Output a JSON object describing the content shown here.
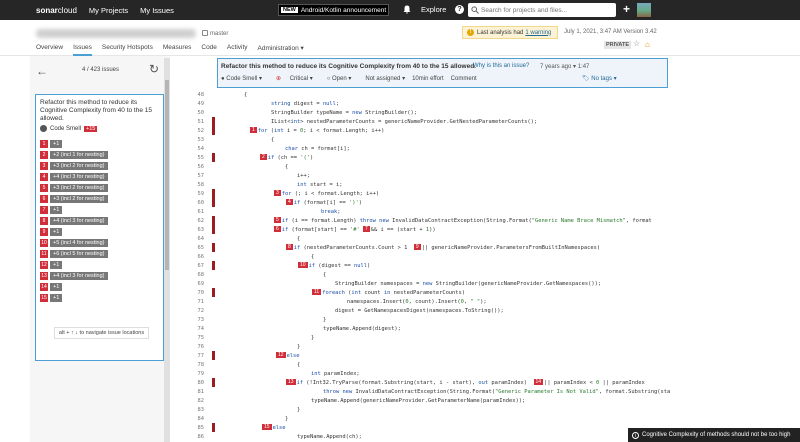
{
  "topbar": {
    "logo_bold": "sonar",
    "logo_rest": "cloud",
    "nav": [
      "My Projects",
      "My Issues"
    ],
    "news_tag": "NEW",
    "news_text": "Android/Kotlin announcement",
    "explore": "Explore",
    "help": "?",
    "search_placeholder": "Search for projects and files...",
    "plus": "+"
  },
  "project": {
    "branch": "master",
    "warning_text": "Last analysis had",
    "warning_link": "1 warning",
    "analysis_date": "July 1, 2021, 3:47 AM  Version 3.42",
    "visibility": "PRIVATE",
    "tabs": [
      "Overview",
      "Issues",
      "Security Hotspots",
      "Measures",
      "Code",
      "Activity",
      "Administration ▾"
    ],
    "active_tab": "Issues"
  },
  "sidebar": {
    "issue_count": "4 / 423 issues",
    "issue_title": "Refactor this method to reduce its Cognitive Complexity from 40 to the 15 allowed.",
    "issue_type": "Code Smell",
    "extra": "+15",
    "locations": [
      {
        "n": "1",
        "t": "+1"
      },
      {
        "n": "2",
        "t": "+2 (incl 1 for nesting)"
      },
      {
        "n": "3",
        "t": "+3 (incl 2 for nesting)"
      },
      {
        "n": "4",
        "t": "+4 (incl 3 for nesting)"
      },
      {
        "n": "5",
        "t": "+3 (incl 2 for nesting)"
      },
      {
        "n": "6",
        "t": "+3 (incl 2 for nesting)"
      },
      {
        "n": "7",
        "t": "+1"
      },
      {
        "n": "8",
        "t": "+4 (incl 3 for nesting)"
      },
      {
        "n": "9",
        "t": "+1"
      },
      {
        "n": "10",
        "t": "+5 (incl 4 for nesting)"
      },
      {
        "n": "11",
        "t": "+6 (incl 5 for nesting)"
      },
      {
        "n": "12",
        "t": "+1"
      },
      {
        "n": "13",
        "t": "+4 (incl 3 for nesting)"
      },
      {
        "n": "14",
        "t": "+1"
      },
      {
        "n": "15",
        "t": "+1"
      }
    ],
    "nav_hint": "alt + ↑ ↓ to navigate issue locations"
  },
  "issue_header": {
    "title": "Refactor this method to reduce its Cognitive Complexity from 40 to the 15 allowed.",
    "why": "Why is this an issue?",
    "age": "7 years ago ▾  1:47",
    "type": "Code Smell ▾",
    "severity": "Critical ▾",
    "status": "Open ▾",
    "assignee": "Not assigned ▾",
    "effort": "10min effort",
    "comment": "Comment",
    "tags": "No tags ▾"
  },
  "toast": "Cognitive Complexity of methods should not be too high",
  "colors": {
    "accent": "#4b9fd5",
    "error": "#d02f3a",
    "topbar": "#262626"
  }
}
